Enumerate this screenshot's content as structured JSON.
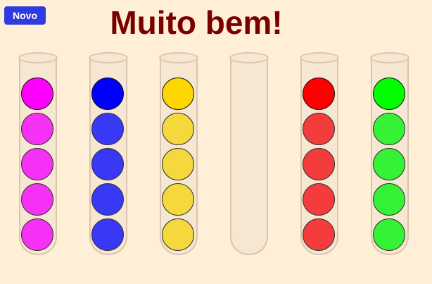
{
  "header": {
    "new_button_label": "Novo",
    "status_title": "Muito bem!"
  },
  "tubes": [
    {
      "balls": [
        "#FF00FF",
        "#F531F5",
        "#F531F5",
        "#F531F5",
        "#F531F5"
      ]
    },
    {
      "balls": [
        "#0000FF",
        "#3838F5",
        "#3838F5",
        "#3838F5",
        "#3838F5"
      ]
    },
    {
      "balls": [
        "#FFD700",
        "#F5D83C",
        "#F5D83C",
        "#F5D83C",
        "#F5D83C"
      ]
    },
    {
      "balls": []
    },
    {
      "balls": [
        "#FF0000",
        "#F53C3C",
        "#F53C3C",
        "#F53C3C",
        "#F53C3C"
      ]
    },
    {
      "balls": [
        "#00FF00",
        "#36F236",
        "#36F236",
        "#36F236",
        "#36F236"
      ]
    }
  ]
}
